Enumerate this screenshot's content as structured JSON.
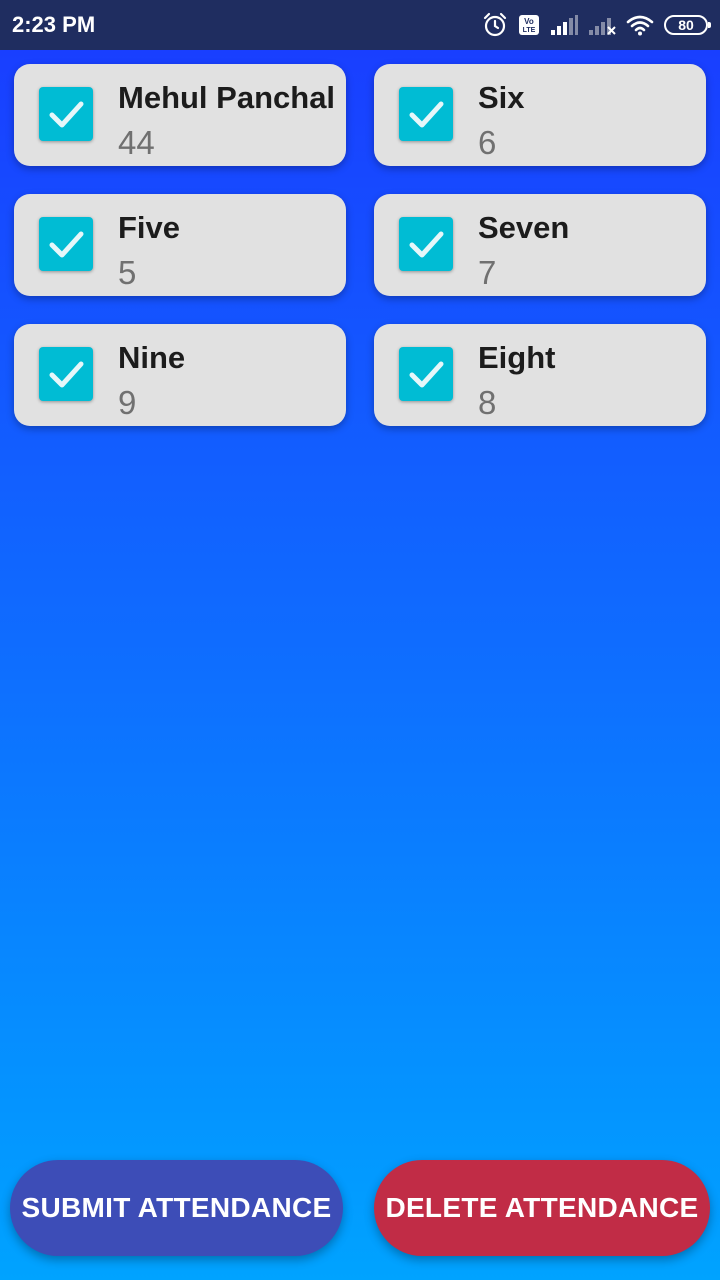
{
  "status_bar": {
    "time": "2:23 PM",
    "battery": "80",
    "network_label": "Vo LTE"
  },
  "students": [
    {
      "name": "Mehul Panchal",
      "roll": "44",
      "checked": true
    },
    {
      "name": "Six",
      "roll": "6",
      "checked": true
    },
    {
      "name": "Five",
      "roll": "5",
      "checked": true
    },
    {
      "name": "Seven",
      "roll": "7",
      "checked": true
    },
    {
      "name": "Nine",
      "roll": "9",
      "checked": true
    },
    {
      "name": "Eight",
      "roll": "8",
      "checked": true
    }
  ],
  "actions": {
    "submit_label": "SUBMIT ATTENDANCE",
    "delete_label": "DELETE ATTENDANCE"
  },
  "icons": {
    "checkbox": "check-icon",
    "alarm": "alarm-icon",
    "signal": "signal-icon",
    "wifi": "wifi-icon",
    "battery": "battery-icon"
  },
  "colors": {
    "status_bar": "#1f2d60",
    "card_bg": "#e1e1e1",
    "checkbox": "#00bcd4",
    "submit_button": "#3d4db7",
    "delete_button": "#c12c46"
  }
}
